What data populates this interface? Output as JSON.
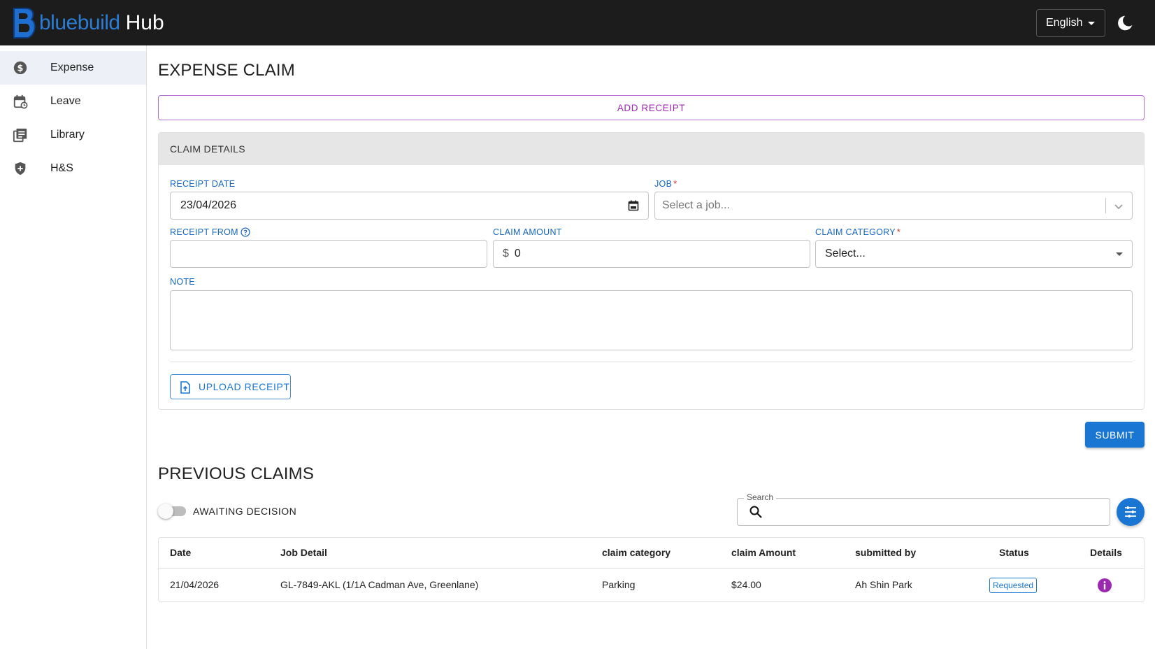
{
  "header": {
    "logo_word": "bluebuild",
    "logo_hub": "Hub",
    "language": "English",
    "icons": {
      "theme": "moon-icon",
      "language_caret": "caret-down-icon"
    }
  },
  "sidebar": {
    "items": [
      {
        "label": "Expense",
        "icon": "dollar-circle-icon",
        "active": true
      },
      {
        "label": "Leave",
        "icon": "calendar-icon",
        "active": false
      },
      {
        "label": "Library",
        "icon": "library-icon",
        "active": false
      },
      {
        "label": "H&S",
        "icon": "shield-plus-icon",
        "active": false
      }
    ]
  },
  "expense_claim": {
    "title": "EXPENSE CLAIM",
    "add_receipt_label": "ADD RECEIPT",
    "card_title": "CLAIM DETAILS",
    "fields": {
      "receipt_date": {
        "label": "RECEIPT DATE",
        "value": "23/04/2026"
      },
      "job": {
        "label": "JOB",
        "required_mark": "*",
        "placeholder": "Select a job..."
      },
      "receipt_from": {
        "label": "RECEIPT FROM",
        "value": ""
      },
      "claim_amount": {
        "label": "CLAIM AMOUNT",
        "prefix": "$",
        "value": "0"
      },
      "claim_category": {
        "label": "CLAIM CATEGORY",
        "required_mark": "*",
        "value": "Select..."
      },
      "note": {
        "label": "NOTE",
        "value": ""
      }
    },
    "upload_label": "UPLOAD RECEIPT",
    "submit_label": "SUBMIT"
  },
  "previous_claims": {
    "title": "PREVIOUS CLAIMS",
    "toggle_label": "AWAITING DECISION",
    "toggle_on": false,
    "search_label": "Search",
    "search_value": "",
    "columns": [
      "Date",
      "Job Detail",
      "claim category",
      "claim Amount",
      "submitted by",
      "Status",
      "Details"
    ],
    "rows": [
      {
        "date": "21/04/2026",
        "job_detail": "GL-7849-AKL (1/1A Cadman Ave, Greenlane)",
        "category": "Parking",
        "amount": "$24.00",
        "submitted_by": "Ah Shin Park",
        "status": "Requested"
      }
    ]
  },
  "colors": {
    "header_bg": "#1c1c1c",
    "brand_blue": "#1976d2",
    "accent_purple": "#9c27b0",
    "required_red": "#d32f2f"
  }
}
